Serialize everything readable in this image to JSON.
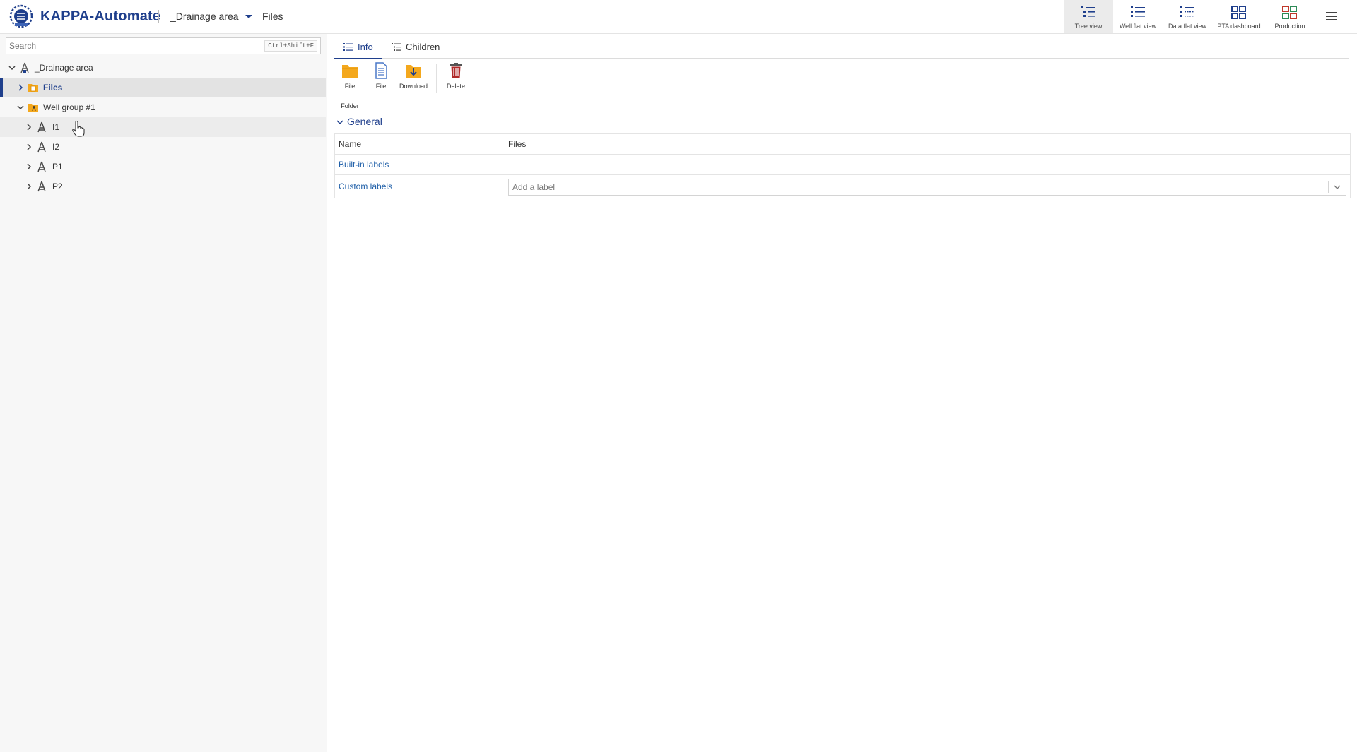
{
  "header": {
    "app_title": "KAPPA-Automate",
    "breadcrumb_area": "_Drainage area",
    "breadcrumb_current": "Files",
    "views": [
      {
        "label": "Tree view",
        "icon": "tree-view-icon",
        "active": true
      },
      {
        "label": "Well flat view",
        "icon": "well-flat-view-icon",
        "active": false
      },
      {
        "label": "Data flat view",
        "icon": "data-flat-view-icon",
        "active": false
      },
      {
        "label": "PTA dashboard",
        "icon": "pta-dashboard-icon",
        "active": false
      },
      {
        "label": "Production",
        "icon": "production-icon",
        "active": false
      }
    ]
  },
  "colors": {
    "brand": "#1f3f8c",
    "link": "#1f5fa8",
    "folder": "#f4a81d",
    "file_icon": "#4a78c8",
    "delete_icon": "#b02a2a"
  },
  "sidebar": {
    "search_placeholder": "Search",
    "search_shortcut": "Ctrl+Shift+F",
    "tree": [
      {
        "label": "_Drainage area",
        "icon": "field-icon",
        "expanded": true
      },
      {
        "label": "Files",
        "icon": "files-folder-icon",
        "expanded": false,
        "selected": true
      },
      {
        "label": "Well group #1",
        "icon": "well-group-icon",
        "expanded": true
      },
      {
        "label": "I1",
        "icon": "well-icon",
        "expanded": false
      },
      {
        "label": "I2",
        "icon": "well-icon",
        "expanded": false
      },
      {
        "label": "P1",
        "icon": "well-icon",
        "expanded": false
      },
      {
        "label": "P2",
        "icon": "well-icon",
        "expanded": false
      }
    ]
  },
  "main": {
    "tabs": [
      {
        "label": "Info",
        "icon": "list-icon",
        "active": true
      },
      {
        "label": "Children",
        "icon": "children-icon",
        "active": false
      }
    ],
    "toolbar": [
      {
        "label_line1": "File",
        "label_line2": "Folder",
        "icon": "folder-icon"
      },
      {
        "label_line1": "File",
        "label_line2": "",
        "icon": "file-icon"
      },
      {
        "label_line1": "Download",
        "label_line2": "",
        "icon": "download-icon"
      },
      {
        "label_line1": "Delete",
        "label_line2": "",
        "icon": "trash-icon"
      }
    ],
    "section_title": "General",
    "rows": {
      "name_label": "Name",
      "name_value": "Files",
      "builtin_label": "Built-in labels",
      "custom_label": "Custom labels",
      "custom_placeholder": "Add a label"
    }
  }
}
